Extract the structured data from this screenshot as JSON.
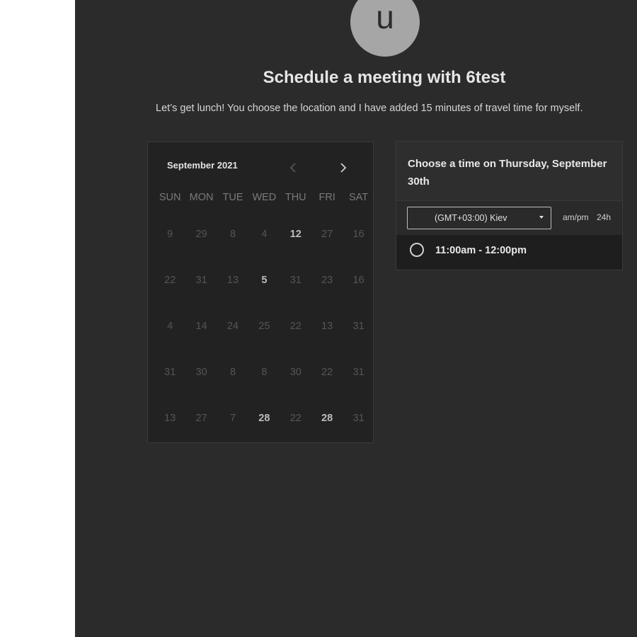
{
  "profile": {
    "avatar_letter": "u"
  },
  "header": {
    "title": "Schedule a meeting with 6test",
    "subtitle": "Let’s get lunch! You choose the location and I have added 15 minutes of travel time for myself."
  },
  "calendar": {
    "month_label": "September 2021",
    "prev_icon": "chevron-left-icon",
    "next_icon": "chevron-right-icon",
    "weekdays": [
      "SUN",
      "MON",
      "TUE",
      "WED",
      "THU",
      "FRI",
      "SAT"
    ],
    "weeks": [
      [
        {
          "d": "9",
          "a": false
        },
        {
          "d": "29",
          "a": false
        },
        {
          "d": "8",
          "a": false
        },
        {
          "d": "4",
          "a": false
        },
        {
          "d": "12",
          "a": true
        },
        {
          "d": "27",
          "a": false
        },
        {
          "d": "16",
          "a": false
        }
      ],
      [
        {
          "d": "22",
          "a": false
        },
        {
          "d": "31",
          "a": false
        },
        {
          "d": "13",
          "a": false
        },
        {
          "d": "5",
          "a": true
        },
        {
          "d": "31",
          "a": false
        },
        {
          "d": "23",
          "a": false
        },
        {
          "d": "16",
          "a": false
        }
      ],
      [
        {
          "d": "4",
          "a": false
        },
        {
          "d": "14",
          "a": false
        },
        {
          "d": "24",
          "a": false
        },
        {
          "d": "25",
          "a": false
        },
        {
          "d": "22",
          "a": false
        },
        {
          "d": "13",
          "a": false
        },
        {
          "d": "31",
          "a": false
        }
      ],
      [
        {
          "d": "31",
          "a": false
        },
        {
          "d": "30",
          "a": false
        },
        {
          "d": "8",
          "a": false
        },
        {
          "d": "8",
          "a": false
        },
        {
          "d": "30",
          "a": false
        },
        {
          "d": "22",
          "a": false
        },
        {
          "d": "31",
          "a": false
        }
      ],
      [
        {
          "d": "13",
          "a": false
        },
        {
          "d": "27",
          "a": false
        },
        {
          "d": "7",
          "a": false
        },
        {
          "d": "28",
          "a": true
        },
        {
          "d": "22",
          "a": false
        },
        {
          "d": "28",
          "a": true
        },
        {
          "d": "31",
          "a": false
        }
      ]
    ]
  },
  "times": {
    "heading": "Choose a time on Thursday, September 30th",
    "timezone": "(GMT+03:00) Kiev",
    "format_ampm": "am/pm",
    "format_24h": "24h",
    "slots": [
      "11:00am - 12:00pm"
    ]
  },
  "colors": {
    "panel_bg": "#2b2b2b",
    "calendar_bg": "#222222",
    "avatar_bg": "#a6a6a6"
  }
}
